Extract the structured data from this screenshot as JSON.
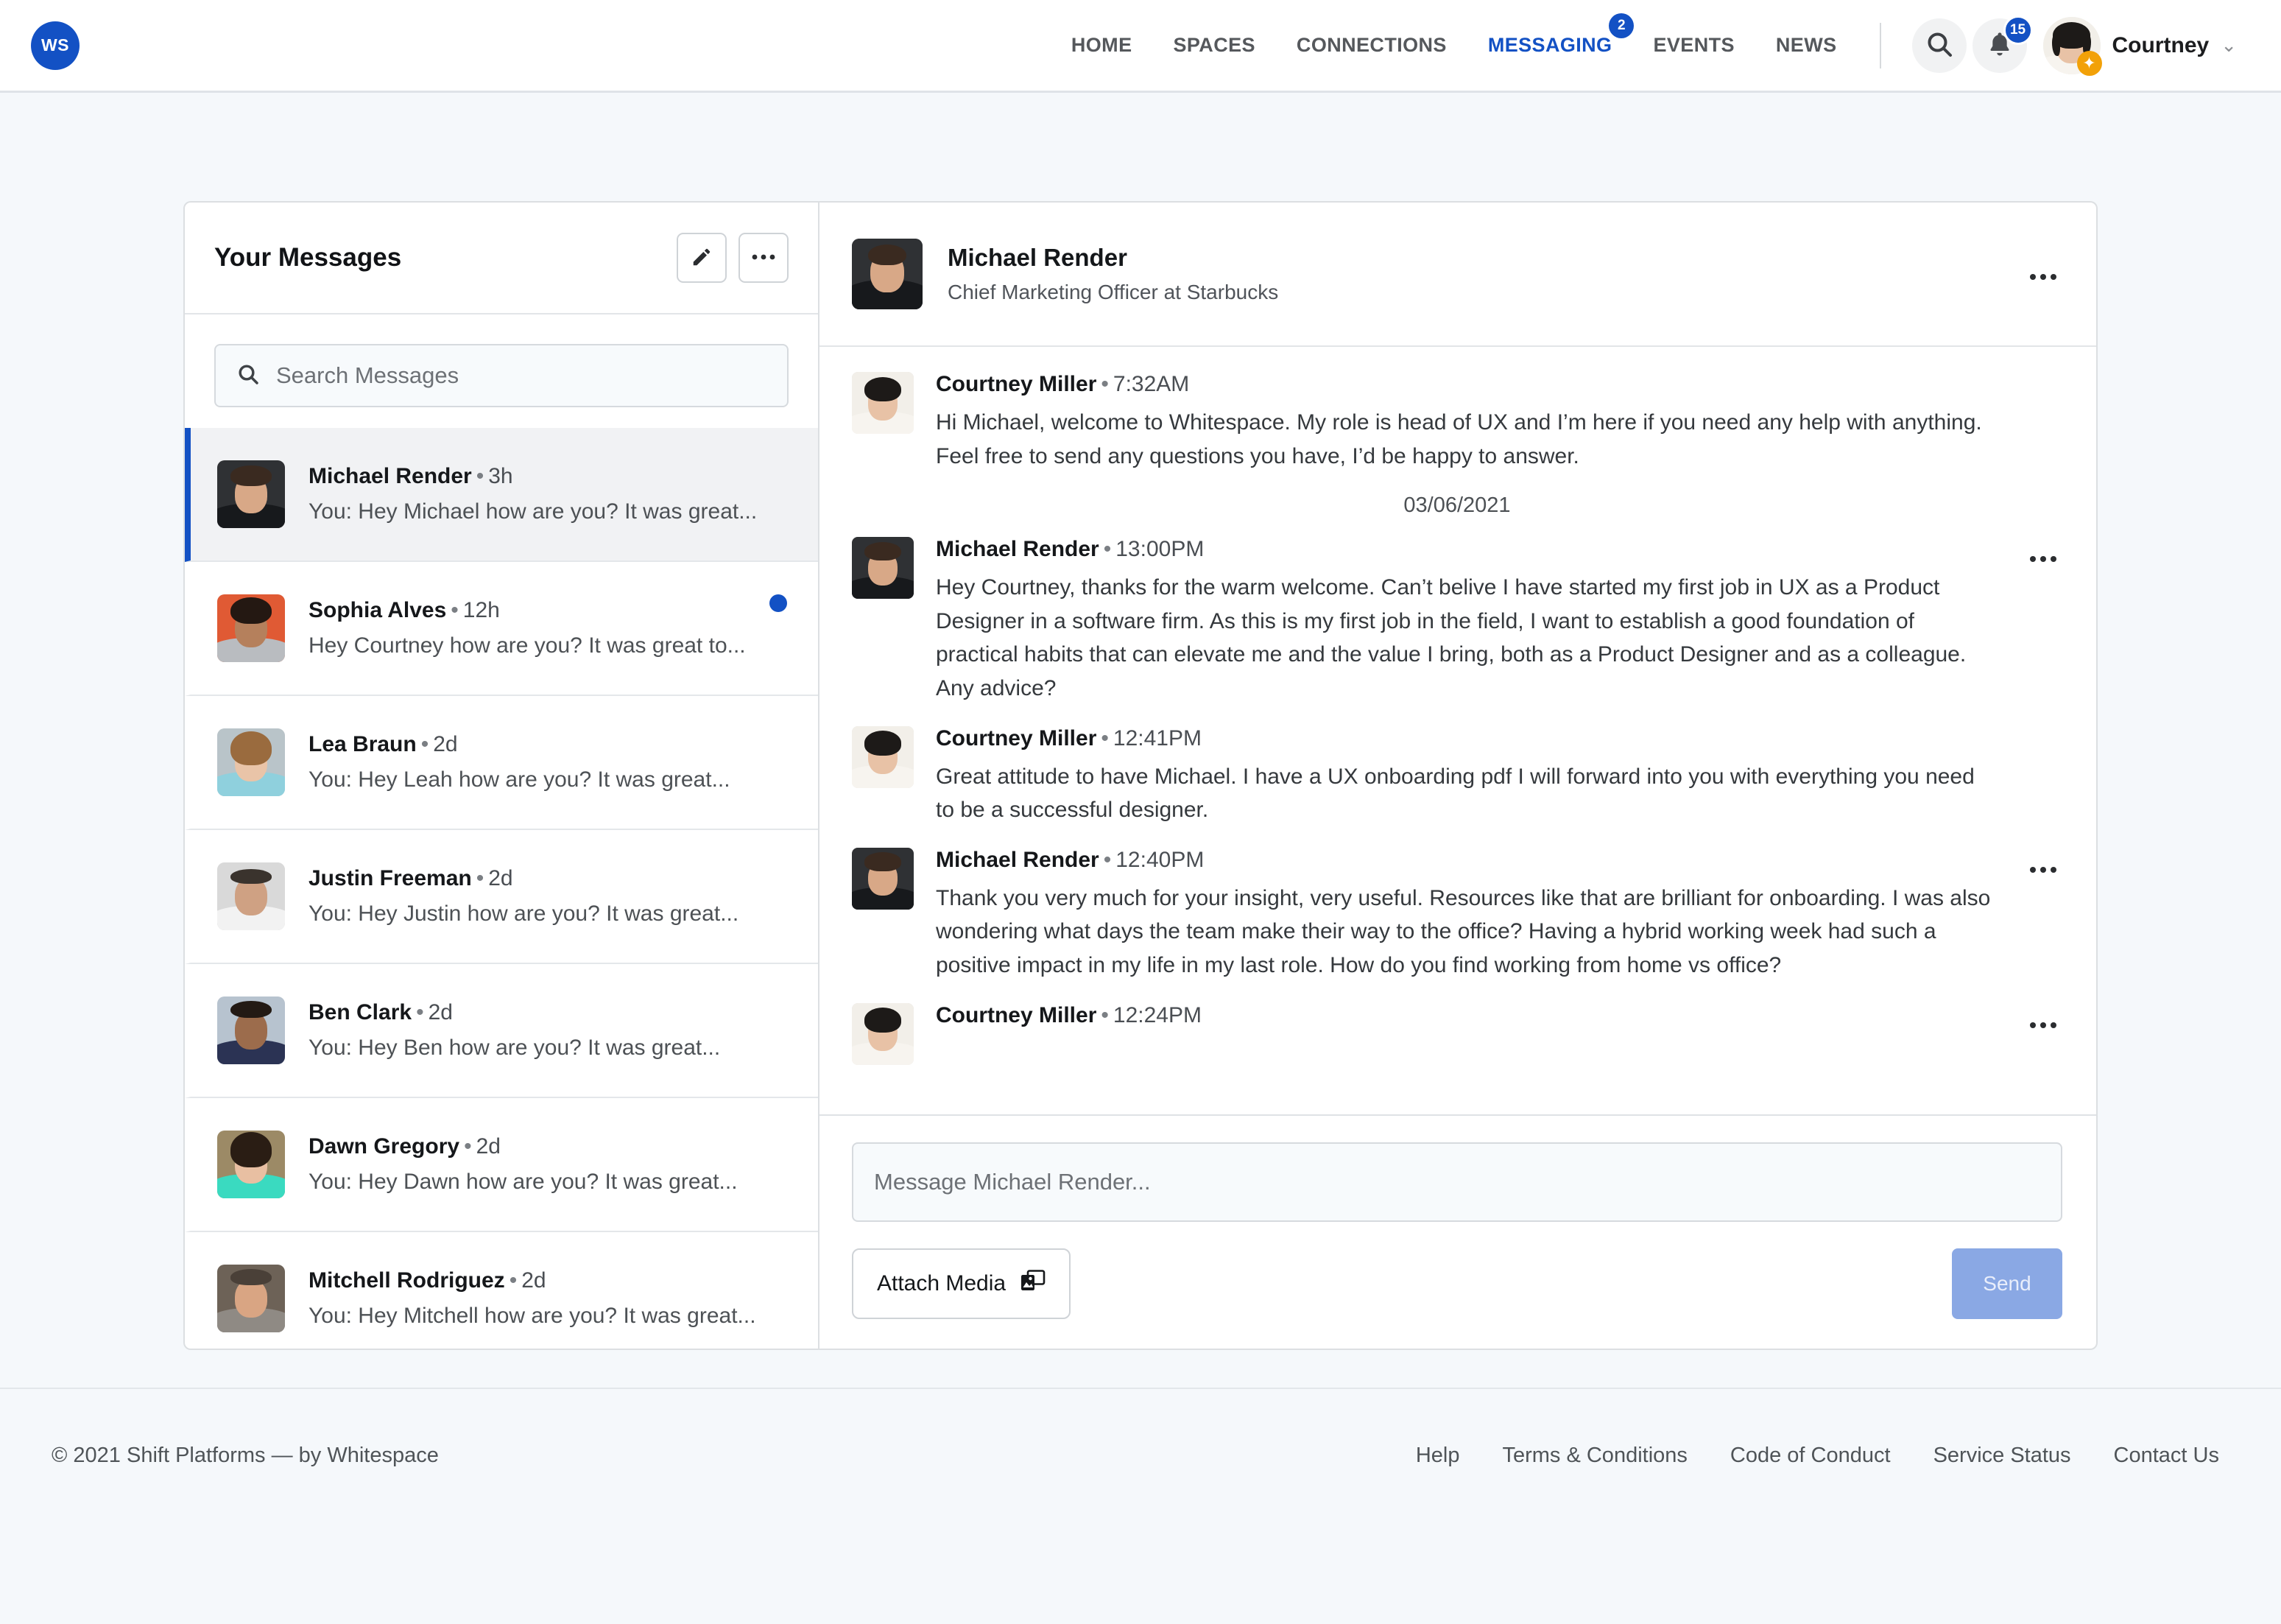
{
  "brand": {
    "logo_text": "WS",
    "accent": "#1351c4"
  },
  "nav": {
    "links": [
      {
        "label": "HOME",
        "active": false,
        "badge": ""
      },
      {
        "label": "SPACES",
        "active": false,
        "badge": ""
      },
      {
        "label": "CONNECTIONS",
        "active": false,
        "badge": ""
      },
      {
        "label": "MESSAGING",
        "active": true,
        "badge": "2"
      },
      {
        "label": "EVENTS",
        "active": false,
        "badge": ""
      },
      {
        "label": "NEWS",
        "active": false,
        "badge": ""
      }
    ],
    "search_icon": "search-icon",
    "bell_icon": "bell-icon",
    "notification_count": "15",
    "user_name": "Courtney",
    "caret": "⌄"
  },
  "left_panel": {
    "title": "Your Messages",
    "compose_icon": "pencil-icon",
    "more_icon": "ellipsis-icon",
    "search": {
      "placeholder": "Search Messages",
      "value": "",
      "icon": "search-icon"
    },
    "conversations": [
      {
        "name": "Michael Render",
        "time": "3h",
        "snippet": "You: Hey Michael how are you? It was great...",
        "active": true,
        "unread": false
      },
      {
        "name": "Sophia Alves",
        "time": "12h",
        "snippet": "Hey Courtney how are you? It was great to...",
        "active": false,
        "unread": true
      },
      {
        "name": "Lea Braun",
        "time": "2d",
        "snippet": "You: Hey Leah how are you? It was great...",
        "active": false,
        "unread": false
      },
      {
        "name": "Justin Freeman",
        "time": "2d",
        "snippet": "You: Hey Justin how are you? It was great...",
        "active": false,
        "unread": false
      },
      {
        "name": "Ben Clark",
        "time": "2d",
        "snippet": "You: Hey Ben how are you? It was great...",
        "active": false,
        "unread": false
      },
      {
        "name": "Dawn Gregory",
        "time": "2d",
        "snippet": "You: Hey Dawn how are you? It was great...",
        "active": false,
        "unread": false
      },
      {
        "name": "Mitchell Rodriguez",
        "time": "2d",
        "snippet": "You: Hey Mitchell how are you? It was great...",
        "active": false,
        "unread": false
      }
    ]
  },
  "conversation": {
    "header": {
      "name": "Michael Render",
      "role": "Chief Marketing Officer at Starbucks",
      "more_icon": "ellipsis-icon"
    },
    "date_separator": "03/06/2021",
    "messages": [
      {
        "author": "Courtney Miller",
        "time": "7:32AM",
        "text": "Hi Michael, welcome to Whitespace. My role is head of UX and I’m here if you need any help with anything. Feel free to send any questions you have, I’d be happy to answer.",
        "has_menu": false,
        "avatar": "courtney"
      },
      {
        "author": "Michael Render",
        "time": "13:00PM",
        "text": "Hey Courtney, thanks for the warm welcome. Can’t belive I have started my first job in UX as a Product Designer in a software firm. As this is my first job in the field, I want to establish a good foundation of practical habits that can elevate me and the value I bring, both as a Product Designer and as a colleague. Any advice?",
        "has_menu": true,
        "avatar": "michael"
      },
      {
        "author": "Courtney Miller",
        "time": "12:41PM",
        "text": "Great attitude to have Michael. I have a UX onboarding pdf I will forward into you with everything you need to be a successful designer.",
        "has_menu": false,
        "avatar": "courtney"
      },
      {
        "author": "Michael Render",
        "time": "12:40PM",
        "text": "Thank you very much for your insight, very useful. Resources like that are brilliant for onboarding. I was also wondering what days the team make their way to the office? Having a hybrid working week had such a positive impact in my life in my last role. How do you find working from home vs office?",
        "has_menu": true,
        "avatar": "michael"
      },
      {
        "author": "Courtney Miller",
        "time": "12:24PM",
        "text": "",
        "has_menu": true,
        "avatar": "courtney"
      }
    ],
    "composer": {
      "placeholder": "Message Michael Render...",
      "value": "",
      "attach_label": "Attach Media",
      "attach_icon": "image-icon",
      "send_label": "Send",
      "send_color": "#8aa8e4"
    }
  },
  "footer": {
    "copyright": "© 2021 Shift Platforms — by Whitespace",
    "links": [
      "Help",
      "Terms & Conditions",
      "Code of Conduct",
      "Service Status",
      "Contact Us"
    ]
  }
}
